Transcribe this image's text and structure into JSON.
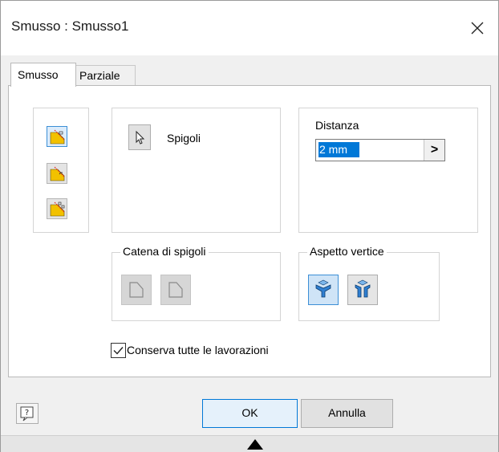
{
  "window": {
    "title": "Smusso : Smusso1"
  },
  "tabs": [
    {
      "label": "Smusso",
      "active": true
    },
    {
      "label": "Parziale",
      "active": false
    }
  ],
  "selection": {
    "edges_label": "Spigoli"
  },
  "distance": {
    "label": "Distanza",
    "value": "2 mm",
    "arrow": ">"
  },
  "edge_chain": {
    "label": "Catena di spigoli"
  },
  "corner_setback": {
    "label": "Aspetto vertice"
  },
  "preserve_all": {
    "label": "Conserva tutte le lavorazioni",
    "checked": true
  },
  "footer": {
    "ok_label": "OK",
    "cancel_label": "Annulla"
  },
  "icons": {
    "close": "close-icon",
    "help": "help-icon",
    "select": "cursor-arrow-icon",
    "modes": [
      "distance-chamfer-icon",
      "distance-angle-chamfer-icon",
      "two-distances-chamfer-icon"
    ],
    "chain": [
      "all-edges-icon",
      "single-edge-icon"
    ],
    "setback": [
      "corner-setback-off-icon",
      "corner-setback-on-icon"
    ],
    "expand": "triangle-up-icon"
  },
  "colors": {
    "accent": "#0078d7",
    "chamfer_yellow": "#f2c100",
    "selected_bg": "#dcecfb"
  }
}
